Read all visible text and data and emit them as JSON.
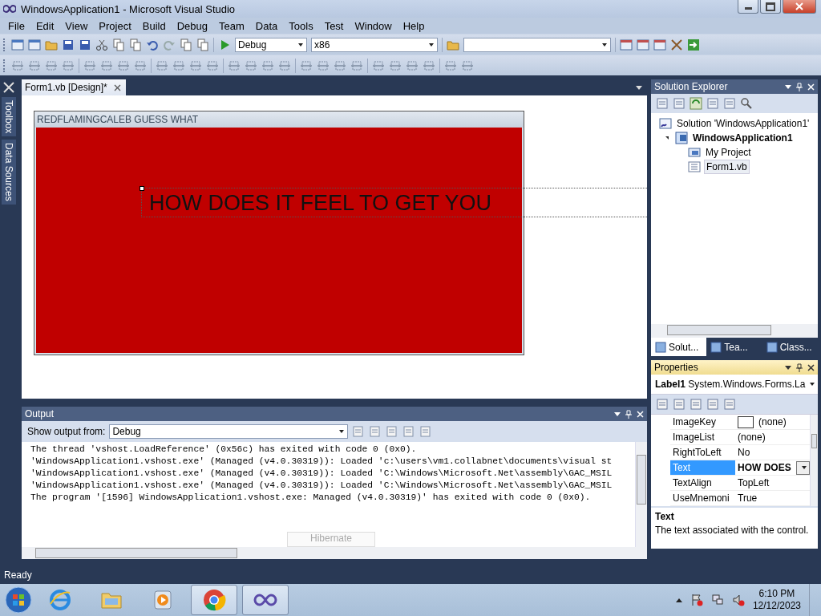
{
  "window": {
    "title": "WindowsApplication1 - Microsoft Visual Studio"
  },
  "menu": [
    "File",
    "Edit",
    "View",
    "Project",
    "Build",
    "Debug",
    "Team",
    "Data",
    "Tools",
    "Test",
    "Window",
    "Help"
  ],
  "toolbar": {
    "configuration": "Debug",
    "platform": "x86"
  },
  "side_tabs": [
    "Toolbox",
    "Data Sources"
  ],
  "document_tabs": [
    {
      "label": "Form1.vb [Design]*",
      "selected": true
    }
  ],
  "designer": {
    "form_title": "REDFLAMINGCALEB GUESS WHAT",
    "label_text": "HOW DOES IT FEEL TO GET YOU"
  },
  "output": {
    "title": "Output",
    "show_from_label": "Show output from:",
    "source": "Debug",
    "lines": [
      "The thread 'vshost.LoadReference' (0x56c) has exited with code 0 (0x0).",
      "'WindowsApplication1.vshost.exe' (Managed (v4.0.30319)): Loaded 'c:\\users\\vm1.collabnet\\documents\\visual st",
      "'WindowsApplication1.vshost.exe' (Managed (v4.0.30319)): Loaded 'C:\\Windows\\Microsoft.Net\\assembly\\GAC_MSIL",
      "'WindowsApplication1.vshost.exe' (Managed (v4.0.30319)): Loaded 'C:\\Windows\\Microsoft.Net\\assembly\\GAC_MSIL",
      "The program '[1596] WindowsApplication1.vshost.exe: Managed (v4.0.30319)' has exited with code 0 (0x0)."
    ],
    "tooltip": "Hibernate"
  },
  "solution_explorer": {
    "title": "Solution Explorer",
    "tree": [
      {
        "label": "Solution 'WindowsApplication1'",
        "kind": "solution",
        "selected": false,
        "children": [
          {
            "label": "WindowsApplication1",
            "kind": "project",
            "selected": false,
            "expanded": true,
            "children": [
              {
                "label": "My Project",
                "kind": "folder",
                "selected": false
              },
              {
                "label": "Form1.vb",
                "kind": "file",
                "selected": true
              }
            ]
          }
        ]
      }
    ],
    "tabs": [
      {
        "label": "Solut...",
        "selected": true
      },
      {
        "label": "Tea...",
        "selected": false
      },
      {
        "label": "Class...",
        "selected": false
      }
    ]
  },
  "properties": {
    "title": "Properties",
    "object_name": "Label1",
    "object_type": "System.Windows.Forms.La",
    "rows": [
      {
        "name": "ImageKey",
        "value": "(none)",
        "kind": "swatch",
        "selected": false,
        "modified": false
      },
      {
        "name": "ImageList",
        "value": "(none)",
        "kind": "plain",
        "selected": false,
        "modified": false
      },
      {
        "name": "RightToLeft",
        "value": "No",
        "kind": "plain",
        "selected": false,
        "modified": false
      },
      {
        "name": "Text",
        "value": "HOW DOES",
        "kind": "plain",
        "selected": true,
        "modified": true
      },
      {
        "name": "TextAlign",
        "value": "TopLeft",
        "kind": "plain",
        "selected": false,
        "modified": false
      },
      {
        "name": "UseMnemoni",
        "value": "True",
        "kind": "plain",
        "selected": false,
        "modified": false
      }
    ],
    "description_title": "Text",
    "description": "The text associated with the control."
  },
  "status_bar": "Ready",
  "taskbar": {
    "apps": [
      {
        "kind": "browser",
        "open": false
      },
      {
        "kind": "folder",
        "open": false
      },
      {
        "kind": "media",
        "open": false
      },
      {
        "kind": "chrome",
        "open": true
      },
      {
        "kind": "studio",
        "open": true
      }
    ],
    "time": "6:10 PM",
    "date": "12/12/2023"
  }
}
